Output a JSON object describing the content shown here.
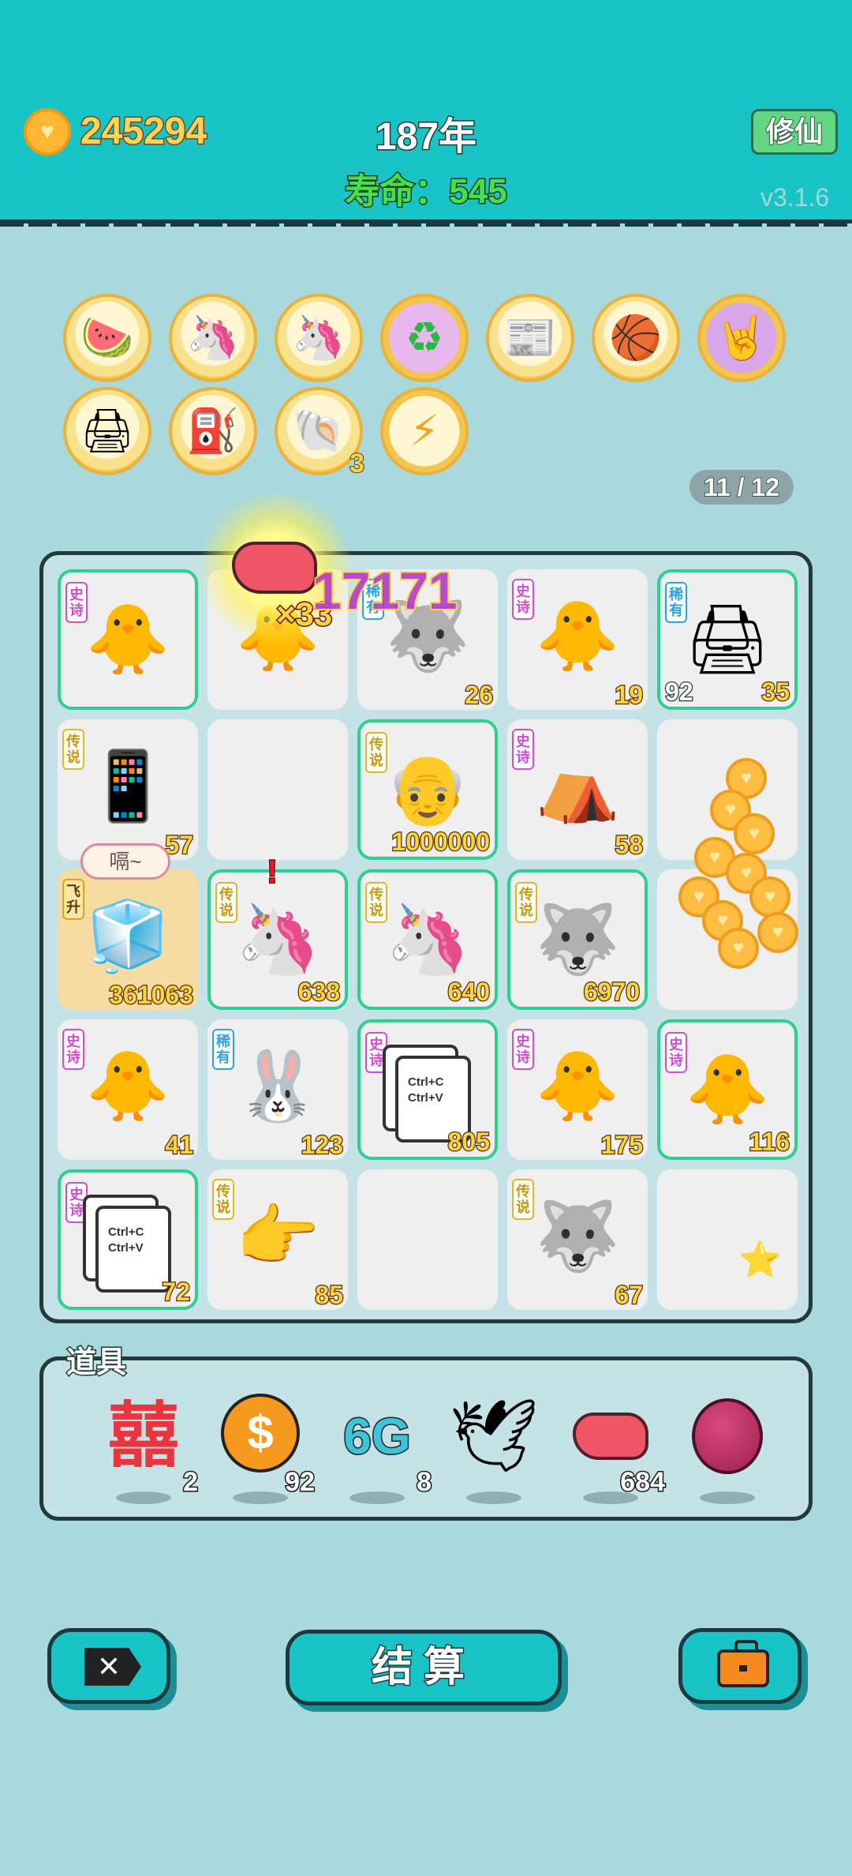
{
  "header": {
    "coins": "245294",
    "year": "187年",
    "life": "寿命：545",
    "xiuxian_label": "修仙",
    "version": "v3.1.6"
  },
  "relics": {
    "row1": [
      "fruit-bowl-icon",
      "unicorn-icon",
      "unicorn-icon",
      "recycle-icon",
      "time-magazine-icon",
      "basketball-icon",
      "rock-hand-icon"
    ],
    "row2": [
      "printer-icon",
      "pump-icon",
      "shell-icon",
      "lightning-icon"
    ],
    "shell_count": "3",
    "page_indicator": "11 / 12"
  },
  "board": {
    "rows": [
      [
        {
          "icon": "chick-grandpa-icon",
          "tag": "史诗",
          "value": ""
        },
        {
          "icon": "chick-grandpa-icon",
          "tag": "",
          "value": ""
        },
        {
          "icon": "husky-icon",
          "tag": "稀有",
          "value": "26"
        },
        {
          "icon": "chick-grandpa-icon",
          "tag": "史诗",
          "value": "19"
        },
        {
          "icon": "printer-icon",
          "tag": "稀有",
          "value": "35",
          "value_left": "92"
        }
      ],
      [
        {
          "icon": "phone-icon",
          "tag": "传说",
          "value": "57"
        },
        {
          "icon": "",
          "tag": "",
          "value": ""
        },
        {
          "icon": "bald-man-icon",
          "tag": "传说",
          "value": "1000000"
        },
        {
          "icon": "rabbit-house-icon",
          "tag": "史诗",
          "value": "58"
        },
        {
          "icon": "",
          "tag": "",
          "value": ""
        }
      ],
      [
        {
          "icon": "fridge-icon",
          "tag": "飞升",
          "value": "361063"
        },
        {
          "icon": "unicorn-icon",
          "tag": "传说",
          "value": "638"
        },
        {
          "icon": "unicorn-icon",
          "tag": "传说",
          "value": "640"
        },
        {
          "icon": "king-husky-icon",
          "tag": "传说",
          "value": "6970"
        },
        {
          "icon": "",
          "tag": "",
          "value": ""
        }
      ],
      [
        {
          "icon": "chick-grandpa-icon",
          "tag": "史诗",
          "value": "41"
        },
        {
          "icon": "rabbit-icon",
          "tag": "稀有",
          "value": "123"
        },
        {
          "icon": "copy-paste-icon",
          "tag": "史诗",
          "value": "805"
        },
        {
          "icon": "chick-grandpa-icon",
          "tag": "史诗",
          "value": "175"
        },
        {
          "icon": "chick-grandpa-icon",
          "tag": "史诗",
          "value": "116"
        }
      ],
      [
        {
          "icon": "copy-paste-icon",
          "tag": "史诗",
          "value": "72"
        },
        {
          "icon": "pointing-hand-icon",
          "tag": "传说",
          "value": "85"
        },
        {
          "icon": "",
          "tag": "",
          "value": ""
        },
        {
          "icon": "king-husky-icon",
          "tag": "传说",
          "value": "67"
        },
        {
          "icon": "star-icon",
          "tag": "",
          "value": ""
        }
      ]
    ],
    "bubble": "嗝~",
    "copy_text": [
      "Ctrl+C",
      "Ctrl+V"
    ],
    "combo_mult": "×33",
    "combo_score": "17171",
    "colors": {
      "highlight": "#2fce91",
      "value_text": "#ffd33c"
    }
  },
  "items": {
    "title": "道具",
    "list": [
      {
        "icon": "double-happiness-icon",
        "count": "2"
      },
      {
        "icon": "dollar-coin-icon",
        "count": "92"
      },
      {
        "icon": "6g-icon",
        "count": "8"
      },
      {
        "icon": "dove-icon",
        "count": ""
      },
      {
        "icon": "liver-icon",
        "count": "684"
      },
      {
        "icon": "lychee-icon",
        "count": ""
      }
    ],
    "sixg_label": "6G"
  },
  "bottom": {
    "close_label": "✕",
    "settle_label": "结算"
  }
}
